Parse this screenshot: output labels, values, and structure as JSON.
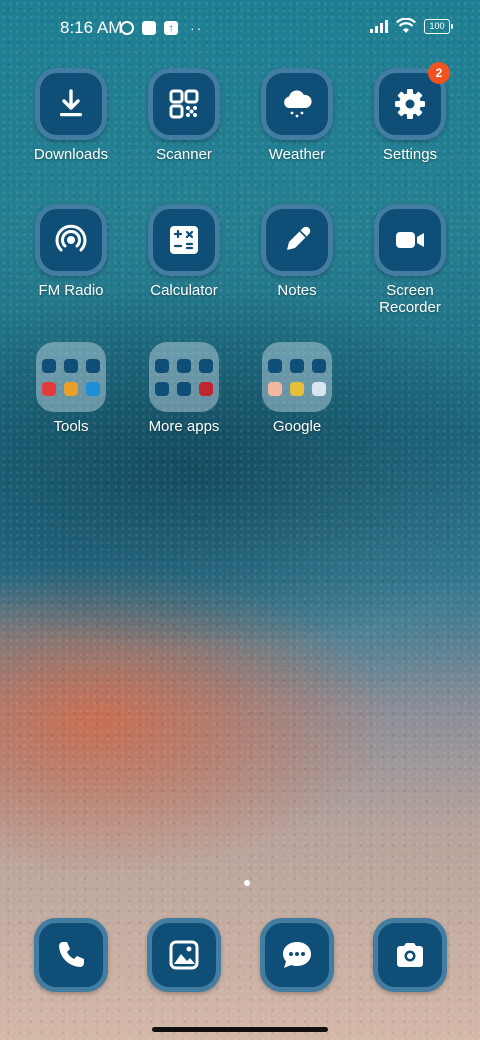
{
  "status": {
    "time": "8:16 AM",
    "battery": "100"
  },
  "apps": [
    {
      "label": "Downloads",
      "icon": "download-icon"
    },
    {
      "label": "Scanner",
      "icon": "qr-scanner-icon"
    },
    {
      "label": "Weather",
      "icon": "weather-cloud-icon"
    },
    {
      "label": "Settings",
      "icon": "gear-icon",
      "badge": "2"
    },
    {
      "label": "FM Radio",
      "icon": "radio-icon"
    },
    {
      "label": "Calculator",
      "icon": "calculator-icon"
    },
    {
      "label": "Notes",
      "icon": "pencil-icon"
    },
    {
      "label": "Screen\nRecorder",
      "icon": "video-camera-icon"
    }
  ],
  "folders": [
    {
      "label": "Tools"
    },
    {
      "label": "More apps"
    },
    {
      "label": "Google"
    }
  ],
  "dock": [
    {
      "icon": "phone-icon"
    },
    {
      "icon": "gallery-icon"
    },
    {
      "icon": "messages-icon"
    },
    {
      "icon": "camera-icon"
    }
  ],
  "colors": {
    "icon_bg": "#0f4e76",
    "badge": "#f0531e"
  }
}
